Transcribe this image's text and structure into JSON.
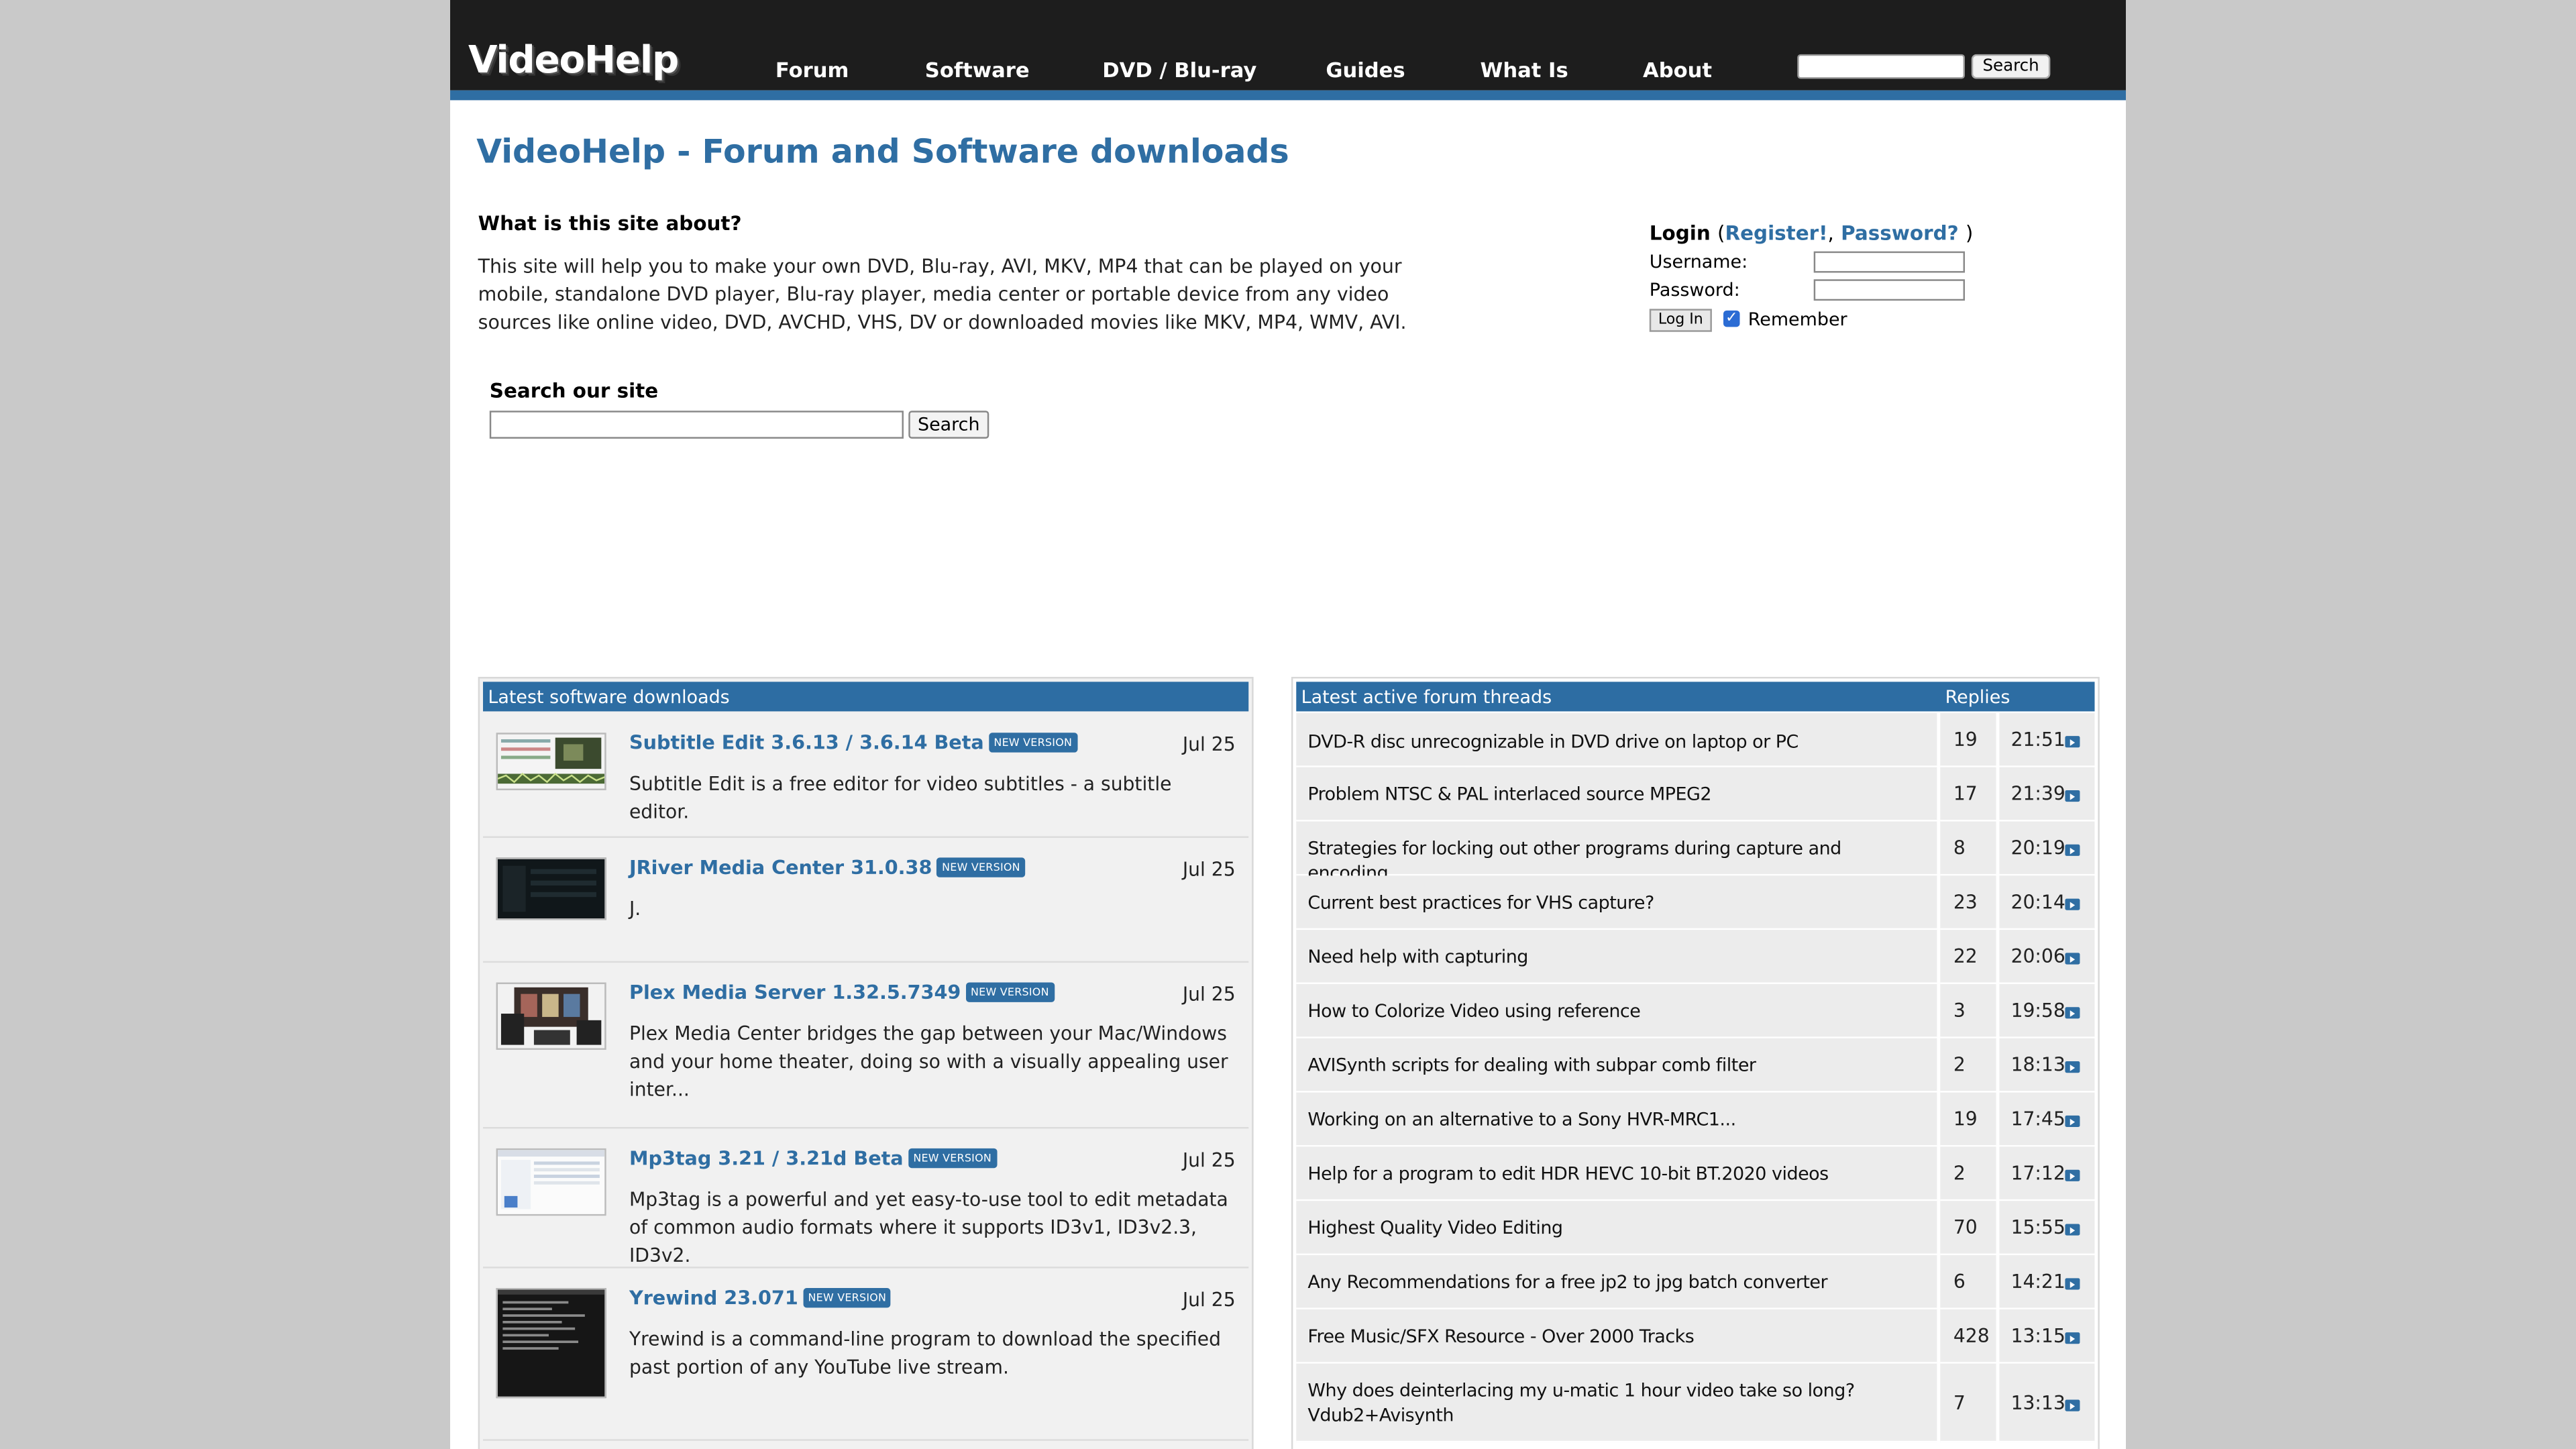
{
  "header": {
    "logo": "VideoHelp",
    "nav": [
      "Forum",
      "Software",
      "DVD / Blu-ray",
      "Guides",
      "What Is",
      "About"
    ],
    "search_button": "Search"
  },
  "main": {
    "title": "VideoHelp - Forum and Software downloads",
    "about_heading": "What is this site about?",
    "about_text": "This site will help you to make your own DVD, Blu-ray, AVI, MKV, MP4 that can be played on your mobile, standalone DVD player, Blu-ray player, media center or portable device from any video sources like online video, DVD, AVCHD, VHS, DV or downloaded movies like MKV, MP4, WMV, AVI.",
    "search_heading": "Search our site",
    "search_button": "Search"
  },
  "login": {
    "title": "Login",
    "open_paren": "(",
    "register_link": "Register!",
    "comma": ",",
    "password_link": "Password?",
    "close_paren": ")",
    "username_label": "Username:",
    "password_label": "Password:",
    "login_button": "Log In",
    "remember_label": "Remember",
    "remember_checked": true
  },
  "software_panel": {
    "heading": "Latest software downloads",
    "badge_label": "NEW VERSION",
    "items": [
      {
        "name": "Subtitle Edit 3.6.13 / 3.6.14 Beta",
        "date": "Jul 25",
        "desc": "Subtitle Edit is a free editor for video subtitles - a subtitle editor."
      },
      {
        "name": "JRiver Media Center 31.0.38",
        "date": "Jul 25",
        "desc": "J."
      },
      {
        "name": "Plex Media Server 1.32.5.7349",
        "date": "Jul 25",
        "desc": "Plex Media Center bridges the gap between your Mac/Windows and your home theater, doing so with a visually appealing user inter..."
      },
      {
        "name": "Mp3tag 3.21 / 3.21d Beta",
        "date": "Jul 25",
        "desc": "Mp3tag is a powerful and yet easy-to-use tool to edit metadata of common audio formats where it supports ID3v1, ID3v2.3, ID3v2."
      },
      {
        "name": "Yrewind 23.071",
        "date": "Jul 25",
        "desc": "Yrewind is a command-line program to download the specified past portion of any YouTube live stream."
      }
    ]
  },
  "forum_panel": {
    "heading": "Latest active forum threads",
    "replies_heading": "Replies",
    "threads": [
      {
        "title": "DVD-R disc unrecognizable in DVD drive on laptop or PC",
        "replies": "19",
        "time": "21:51"
      },
      {
        "title": "Problem NTSC & PAL interlaced source MPEG2",
        "replies": "17",
        "time": "21:39"
      },
      {
        "title": "Strategies for locking out other programs during capture and encoding",
        "replies": "8",
        "time": "20:19"
      },
      {
        "title": "Current best practices for VHS capture?",
        "replies": "23",
        "time": "20:14"
      },
      {
        "title": "Need help with capturing",
        "replies": "22",
        "time": "20:06"
      },
      {
        "title": "How to Colorize Video using reference",
        "replies": "3",
        "time": "19:58"
      },
      {
        "title": "AVISynth scripts for dealing with subpar comb filter",
        "replies": "2",
        "time": "18:13"
      },
      {
        "title": "Working on an alternative to a Sony HVR-MRC1...",
        "replies": "19",
        "time": "17:45"
      },
      {
        "title": "Help for a program to edit HDR HEVC 10-bit BT.2020 videos",
        "replies": "2",
        "time": "17:12"
      },
      {
        "title": "Highest Quality Video Editing",
        "replies": "70",
        "time": "15:55"
      },
      {
        "title": "Any Recommendations for a free jp2 to jpg batch converter",
        "replies": "6",
        "time": "14:21"
      },
      {
        "title": "Free Music/SFX Resource - Over 2000 Tracks",
        "replies": "428",
        "time": "13:15"
      },
      {
        "title": "Why does deinterlacing my u-matic 1 hour video take so long? Vdub2+Avisynth",
        "replies": "7",
        "time": "13:13"
      }
    ]
  }
}
